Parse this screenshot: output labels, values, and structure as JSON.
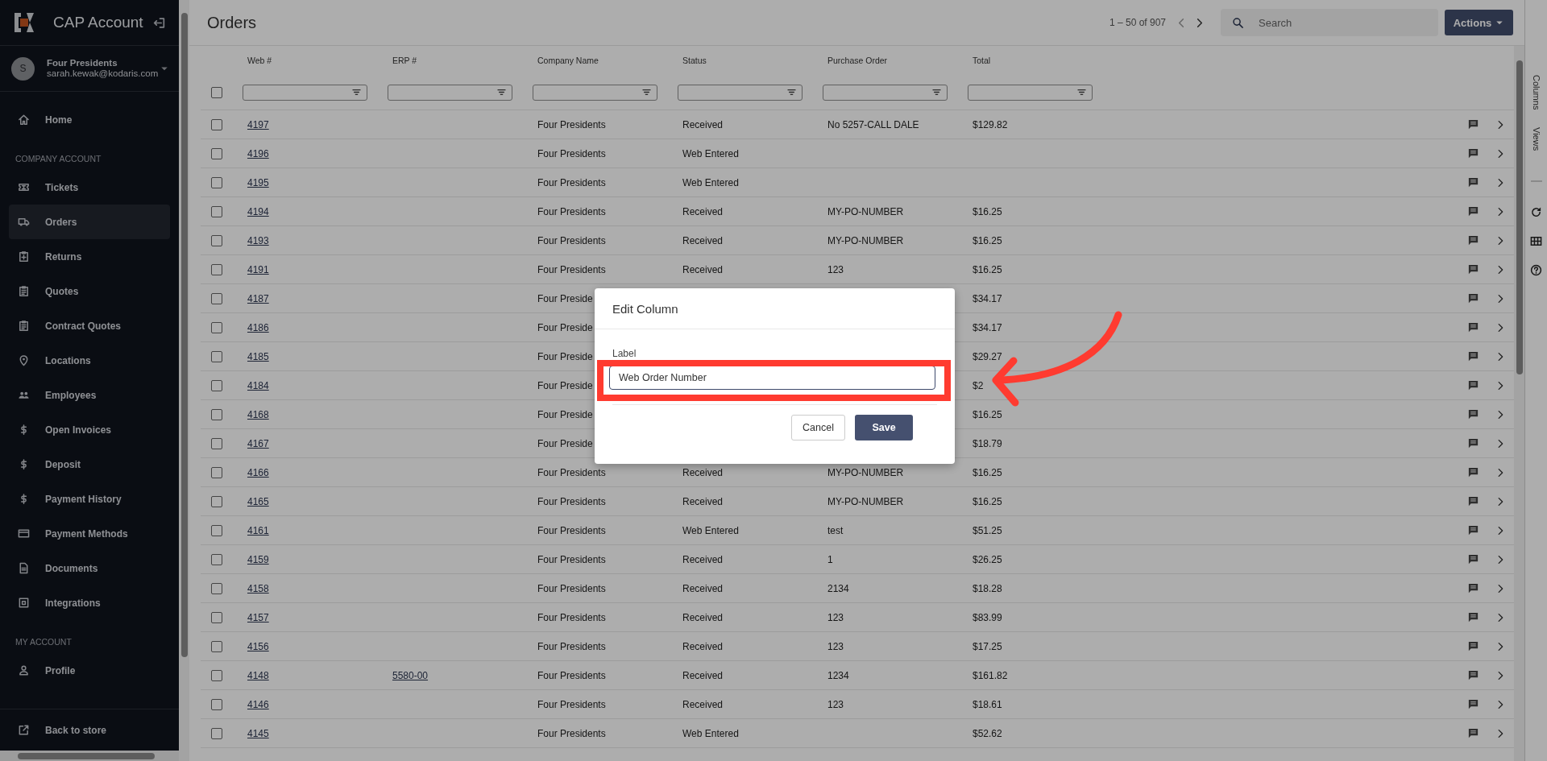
{
  "sidebar": {
    "title": "CAP Account",
    "account": {
      "avatar": "S",
      "name": "Four Presidents",
      "email": "sarah.kewak@kodaris.com"
    },
    "sections": [
      {
        "items": [
          {
            "label": "Home",
            "selected": false
          }
        ]
      },
      {
        "heading": "COMPANY ACCOUNT",
        "items": [
          {
            "label": "Tickets",
            "selected": false
          },
          {
            "label": "Orders",
            "selected": true
          },
          {
            "label": "Returns",
            "selected": false
          },
          {
            "label": "Quotes",
            "selected": false
          },
          {
            "label": "Contract Quotes",
            "selected": false
          },
          {
            "label": "Locations",
            "selected": false
          },
          {
            "label": "Employees",
            "selected": false
          },
          {
            "label": "Open Invoices",
            "selected": false
          },
          {
            "label": "Deposit",
            "selected": false
          },
          {
            "label": "Payment History",
            "selected": false
          },
          {
            "label": "Payment Methods",
            "selected": false
          },
          {
            "label": "Documents",
            "selected": false
          },
          {
            "label": "Integrations",
            "selected": false
          }
        ]
      },
      {
        "heading": "MY ACCOUNT",
        "items": [
          {
            "label": "Profile",
            "selected": false
          }
        ]
      }
    ],
    "footer": {
      "label": "Back to store"
    }
  },
  "page": {
    "title": "Orders",
    "pagination": "1 – 50 of 907",
    "search": {
      "placeholder": "Search"
    },
    "actions_button": "Actions"
  },
  "table": {
    "select_all_checked": false,
    "columns": [
      "Web #",
      "ERP #",
      "Company Name",
      "Status",
      "Purchase Order",
      "Total"
    ],
    "rows": [
      {
        "checked": false,
        "web": "4197",
        "company": "Four Presidents",
        "status": "Received",
        "po": "No 5257-CALL DALE",
        "total": "$129.82"
      },
      {
        "checked": false,
        "web": "4196",
        "company": "Four Presidents",
        "status": "Web Entered"
      },
      {
        "checked": false,
        "web": "4195",
        "company": "Four Presidents",
        "status": "Web Entered"
      },
      {
        "checked": false,
        "web": "4194",
        "company": "Four Presidents",
        "status": "Received",
        "po": "MY-PO-NUMBER",
        "total": "$16.25"
      },
      {
        "checked": false,
        "web": "4193",
        "company": "Four Presidents",
        "status": "Received",
        "po": "MY-PO-NUMBER",
        "total": "$16.25"
      },
      {
        "checked": false,
        "web": "4191",
        "company": "Four Presidents",
        "status": "Received",
        "po": "123",
        "total": "$16.25"
      },
      {
        "checked": false,
        "web": "4187",
        "company": "Four Preside",
        "total": "$34.17"
      },
      {
        "checked": false,
        "web": "4186",
        "company": "Four Preside",
        "total": "$34.17"
      },
      {
        "checked": false,
        "web": "4185",
        "company": "Four Preside",
        "total": "$29.27"
      },
      {
        "checked": false,
        "web": "4184",
        "company": "Four Preside",
        "total": "$2"
      },
      {
        "checked": false,
        "web": "4168",
        "company": "Four Preside",
        "total": "$16.25"
      },
      {
        "checked": false,
        "web": "4167",
        "company": "Four Preside",
        "total": "$18.79"
      },
      {
        "checked": false,
        "web": "4166",
        "company": "Four Presidents",
        "status": "Received",
        "po": "MY-PO-NUMBER",
        "total": "$16.25"
      },
      {
        "checked": false,
        "web": "4165",
        "company": "Four Presidents",
        "status": "Received",
        "po": "MY-PO-NUMBER",
        "total": "$16.25"
      },
      {
        "checked": false,
        "web": "4161",
        "company": "Four Presidents",
        "status": "Web Entered",
        "po": "test",
        "total": "$51.25"
      },
      {
        "checked": false,
        "web": "4159",
        "company": "Four Presidents",
        "status": "Received",
        "po": "1",
        "total": "$26.25"
      },
      {
        "checked": false,
        "web": "4158",
        "company": "Four Presidents",
        "status": "Received",
        "po": "2134",
        "total": "$18.28"
      },
      {
        "checked": false,
        "web": "4157",
        "company": "Four Presidents",
        "status": "Received",
        "po": "123",
        "total": "$83.99"
      },
      {
        "checked": false,
        "web": "4156",
        "company": "Four Presidents",
        "status": "Received",
        "po": "123",
        "total": "$17.25"
      },
      {
        "checked": false,
        "web": "4148",
        "erp": "5580-00",
        "company": "Four Presidents",
        "status": "Received",
        "po": "1234",
        "total": "$161.82"
      },
      {
        "checked": false,
        "web": "4146",
        "company": "Four Presidents",
        "status": "Received",
        "po": "123",
        "total": "$18.61"
      },
      {
        "checked": false,
        "web": "4145",
        "company": "Four Presidents",
        "status": "Web Entered",
        "total": "$52.62"
      }
    ]
  },
  "right_rail": {
    "tabs": [
      "Columns",
      "Views"
    ]
  },
  "dialog": {
    "title": "Edit Column",
    "field": {
      "label": "Label",
      "value": "Web Order Number"
    },
    "buttons": [
      {
        "label": "Cancel",
        "kind": "secondary"
      },
      {
        "label": "Save",
        "kind": "primary"
      }
    ]
  }
}
